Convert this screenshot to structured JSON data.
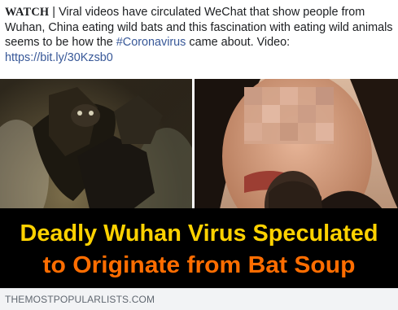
{
  "post": {
    "lead": "WATCH",
    "separator": " | ",
    "text_before_hashtag": "Viral videos have circulated WeChat that show people from Wuhan, China eating wild bats and this fascination with eating wild animals seems to be how the ",
    "hashtag": "#Coronavirus",
    "text_after_hashtag": " came about. Video: ",
    "link": "https://bit.ly/30Kzsb0"
  },
  "media": {
    "headline_line1": "Deadly Wuhan Virus Speculated",
    "headline_line2": "to Originate from Bat Soup",
    "headline_color1": "#ffd200",
    "headline_color2": "#ff6d00",
    "banner_color": "#000000"
  },
  "link_preview": {
    "domain": "THEMOSTPOPULARLISTS.COM"
  },
  "colors": {
    "link": "#385898",
    "text": "#1c1e21",
    "footer_bg": "#f2f3f5",
    "footer_text": "#606770"
  }
}
